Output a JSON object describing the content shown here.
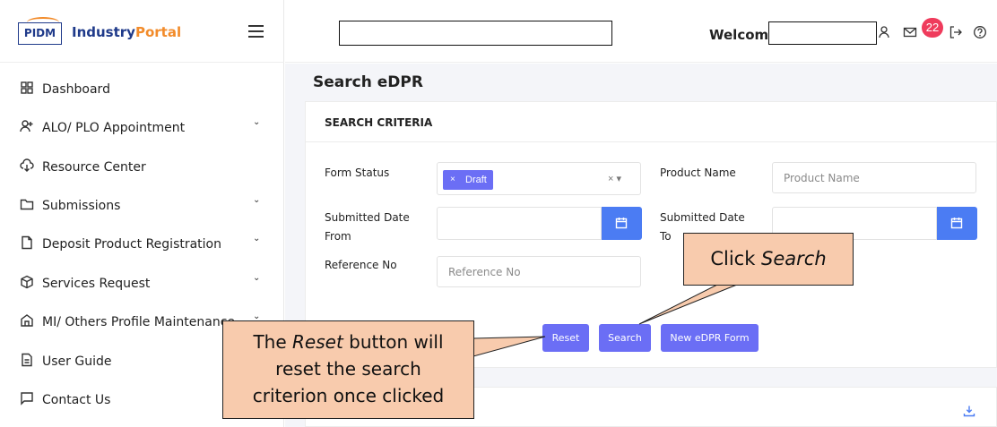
{
  "brand": {
    "logo_text": "PIDM",
    "name_part1": "Industry",
    "name_part2": "Portal"
  },
  "sidebar": {
    "items": [
      {
        "label": "Dashboard",
        "icon": "dashboard-icon",
        "has_chevron": false
      },
      {
        "label": "ALO/ PLO Appointment",
        "icon": "user-plus-icon",
        "has_chevron": true
      },
      {
        "label": "Resource Center",
        "icon": "cloud-download-icon",
        "has_chevron": false
      },
      {
        "label": "Submissions",
        "icon": "folder-icon",
        "has_chevron": true
      },
      {
        "label": "Deposit Product Registration",
        "icon": "document-icon",
        "has_chevron": true
      },
      {
        "label": "Services Request",
        "icon": "box-icon",
        "has_chevron": true
      },
      {
        "label": "MI/ Others Profile Maintenance",
        "icon": "home-icon",
        "has_chevron": true
      },
      {
        "label": "User Guide",
        "icon": "guide-icon",
        "has_chevron": false
      },
      {
        "label": "Contact Us",
        "icon": "chat-icon",
        "has_chevron": false
      }
    ],
    "chevron": "⌄"
  },
  "header": {
    "search_value": "",
    "welcome_label": "Welcome",
    "welcome_value": "",
    "notification_count": "22",
    "icons": [
      "user-icon",
      "mail-icon",
      "logout-icon",
      "help-icon"
    ]
  },
  "main": {
    "title": "Search eDPR",
    "criteria_header": "SEARCH CRITERIA",
    "form_status_label": "Form Status",
    "form_status_chip": "Draft",
    "chip_remove": "×",
    "select_controls": "× ▾",
    "product_name_label": "Product Name",
    "product_name_placeholder": "Product Name",
    "submitted_from_label_1": "Submitted Date",
    "submitted_from_label_2": "From",
    "submitted_to_label_1": "Submitted Date",
    "submitted_to_label_2": "To",
    "reference_label": "Reference No",
    "reference_placeholder": "Reference No",
    "buttons": {
      "reset": "Reset",
      "search": "Search",
      "new_form": "New eDPR Form"
    }
  },
  "callouts": {
    "search": {
      "text_prefix": "Click ",
      "text_em": "Search"
    },
    "reset": {
      "line1_prefix": "The ",
      "line1_em": "Reset",
      "line1_suffix": " button will",
      "line2": "reset the search",
      "line3": "criterion once clicked"
    }
  },
  "colors": {
    "accent": "#6b6ef5",
    "calendar": "#4b7cf3",
    "badge": "#ef3b5c",
    "callout": "#f8cbad",
    "brand_blue": "#1f3a8a",
    "brand_orange": "#f28b2a"
  }
}
